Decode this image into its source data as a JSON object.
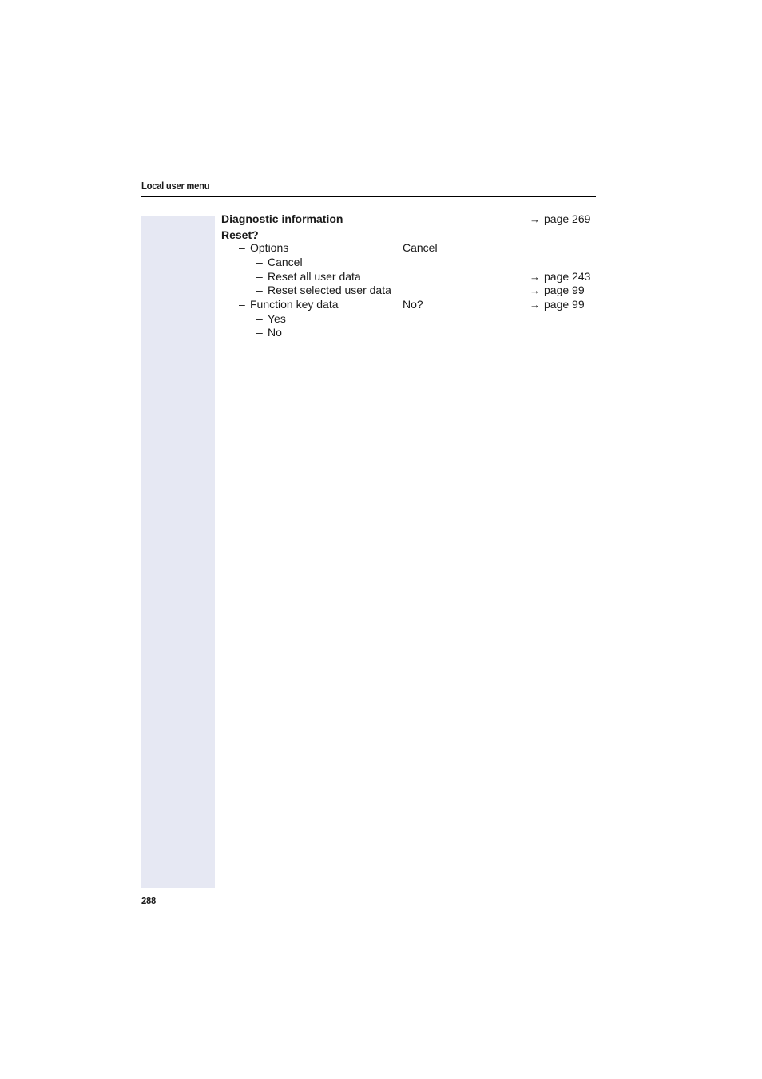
{
  "header": {
    "title": "Local user menu"
  },
  "footer": {
    "page_number": "288"
  },
  "sidebar": {
    "color": "#e6e8f3"
  },
  "content": {
    "diagnostic": {
      "label": "Diagnostic information",
      "ref": "page 269"
    },
    "reset": {
      "label": "Reset?",
      "options": {
        "label": "Options",
        "default": "Cancel"
      },
      "options_items": [
        {
          "label": "Cancel"
        },
        {
          "label": "Reset all user data",
          "ref": "page 243"
        },
        {
          "label": "Reset selected user data",
          "ref": "page 99"
        }
      ],
      "function_key": {
        "label": "Function key data",
        "default": "No?",
        "ref": "page 99"
      },
      "function_key_items": [
        {
          "label": "Yes"
        },
        {
          "label": "No"
        }
      ]
    },
    "dash": "–",
    "arrow_icon": "→"
  }
}
